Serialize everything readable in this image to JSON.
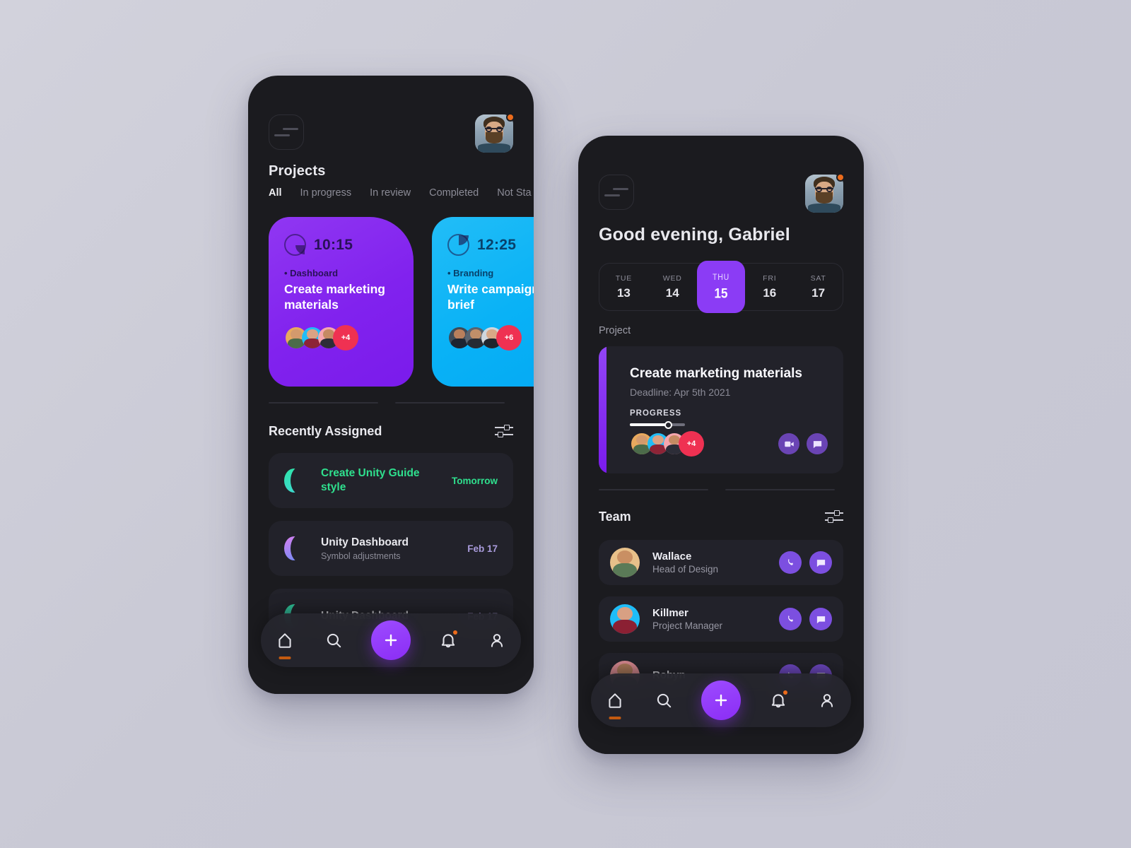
{
  "background": {
    "color_top_left": "#d2d2dc",
    "color_bottom_right": "#c6c6d3"
  },
  "theme": {
    "phone_bg": "#1b1b1f",
    "card_bg": "#22222a",
    "accent_purple": "#8b3cf5",
    "accent_blue": "#09b2f6",
    "accent_green": "#2fe08e",
    "accent_red": "#ef3152",
    "accent_orange": "#ec6c1c"
  },
  "projects_screen": {
    "menu_icon": "menu-icon",
    "avatar_icon": "user-avatar",
    "status_dot": "online-dot",
    "title": "Projects",
    "tabs": [
      {
        "label": "All",
        "active": true
      },
      {
        "label": "In progress",
        "active": false
      },
      {
        "label": "In review",
        "active": false
      },
      {
        "label": "Completed",
        "active": false
      },
      {
        "label": "Not Sta",
        "active": false
      }
    ],
    "project_cards": [
      {
        "time": "10:15",
        "clock_icon": "clock-icon",
        "category": "Dashboard",
        "title": "Create marketing materials",
        "extra_members": "+4",
        "color": "#8122ee"
      },
      {
        "time": "12:25",
        "clock_icon": "clock-icon",
        "category": "Branding",
        "title": "Write campaign brief",
        "extra_members": "+6",
        "color": "#09b2f6"
      }
    ],
    "section": {
      "title": "Recently Assigned",
      "filter_icon": "filter-sliders-icon"
    },
    "tasks": [
      {
        "icon": "moon-icon",
        "name": "Create Unity Guide style",
        "subtitle": "",
        "due": "Tomorrow",
        "highlight": true
      },
      {
        "icon": "moon-icon",
        "name": "Unity Dashboard",
        "subtitle": "Symbol adjustments",
        "due": "Feb 17",
        "highlight": false
      },
      {
        "icon": "moon-icon",
        "name": "Unity Dashboard",
        "subtitle": "",
        "due": "Feb 17",
        "highlight": false
      }
    ],
    "navbar": {
      "items": [
        {
          "icon": "home-icon",
          "active": true
        },
        {
          "icon": "search-icon",
          "active": false
        },
        {
          "icon": "plus-icon",
          "active": false,
          "fab": true
        },
        {
          "icon": "bell-icon",
          "active": false,
          "badge": true
        },
        {
          "icon": "profile-icon",
          "active": false
        }
      ]
    }
  },
  "home_screen": {
    "menu_icon": "menu-icon",
    "avatar_icon": "user-avatar",
    "status_dot": "online-dot",
    "greeting": "Good evening, Gabriel",
    "week": [
      {
        "name": "TUE",
        "day": "13",
        "selected": false
      },
      {
        "name": "WED",
        "day": "14",
        "selected": false
      },
      {
        "name": "THU",
        "day": "15",
        "selected": true
      },
      {
        "name": "FRI",
        "day": "16",
        "selected": false
      },
      {
        "name": "SAT",
        "day": "17",
        "selected": false
      }
    ],
    "project_label": "Project",
    "project": {
      "title": "Create marketing materials",
      "deadline": "Deadline: Apr 5th 2021",
      "progress_label": "PROGRESS",
      "progress_percent": 70,
      "extra_members": "+4",
      "actions": [
        {
          "icon": "video-call-icon"
        },
        {
          "icon": "chat-icon"
        }
      ]
    },
    "team_section": {
      "title": "Team",
      "filter_icon": "filter-sliders-icon"
    },
    "team": [
      {
        "name": "Wallace",
        "role": "Head of Design",
        "avatar": "wallace-avatar",
        "actions": [
          {
            "icon": "phone-icon"
          },
          {
            "icon": "chat-icon"
          }
        ]
      },
      {
        "name": "Killmer",
        "role": "Project Manager",
        "avatar": "killmer-avatar",
        "actions": [
          {
            "icon": "phone-icon"
          },
          {
            "icon": "chat-icon"
          }
        ]
      },
      {
        "name": "Robyn",
        "role": "",
        "avatar": "robyn-avatar",
        "actions": [
          {
            "icon": "phone-icon"
          },
          {
            "icon": "chat-icon"
          }
        ]
      }
    ],
    "navbar": {
      "items": [
        {
          "icon": "home-icon",
          "active": true
        },
        {
          "icon": "search-icon",
          "active": false
        },
        {
          "icon": "plus-icon",
          "active": false,
          "fab": true
        },
        {
          "icon": "bell-icon",
          "active": false,
          "badge": true
        },
        {
          "icon": "profile-icon",
          "active": false
        }
      ]
    }
  }
}
